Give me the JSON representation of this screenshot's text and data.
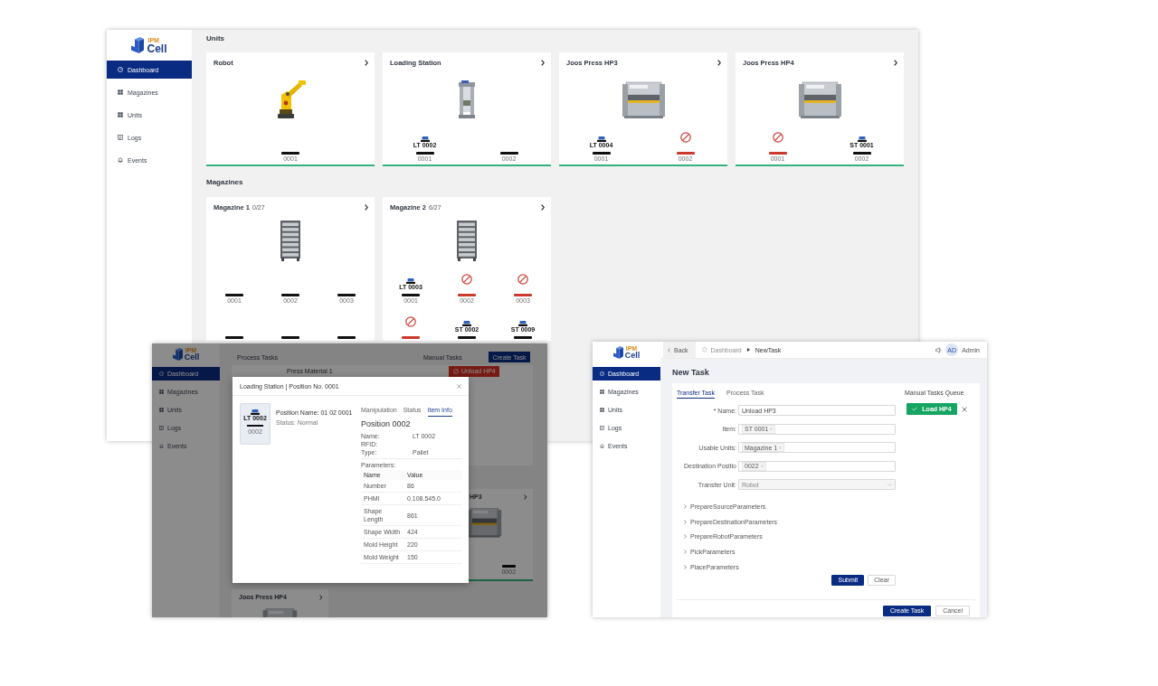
{
  "dashboard_window": {
    "logo": {
      "tag": "IPM",
      "name": "Cell"
    },
    "sidebar": [
      {
        "label": "Dashboard",
        "kind": "gauge",
        "selected": true
      },
      {
        "label": "Magazines",
        "kind": "grid",
        "selected": false
      },
      {
        "label": "Units",
        "kind": "grid",
        "selected": false
      },
      {
        "label": "Logs",
        "kind": "document",
        "selected": false
      },
      {
        "label": "Events",
        "kind": "bell",
        "selected": false
      }
    ],
    "units": {
      "title": "Units",
      "cards": [
        {
          "title": "Robot",
          "kind": "robot",
          "positions": [
            {
              "number": "0001",
              "blocked": false
            }
          ]
        },
        {
          "title": "Loading Station",
          "kind": "station",
          "positions": [
            {
              "number": "0001",
              "item": "LT 0002",
              "blocked": false
            },
            {
              "number": "0002",
              "blocked": false
            }
          ]
        },
        {
          "title": "Joos Press HP3",
          "kind": "press",
          "positions": [
            {
              "number": "0001",
              "item": "LT 0004",
              "blocked": false
            },
            {
              "number": "0002",
              "blocked": true
            }
          ]
        },
        {
          "title": "Joos Press HP4",
          "kind": "press",
          "positions": [
            {
              "number": "0001",
              "blocked": true
            },
            {
              "number": "0002",
              "item": "ST 0001",
              "blocked": false
            }
          ]
        }
      ]
    },
    "magazines": {
      "title": "Magazines",
      "cards": [
        {
          "title": "Magazine 1",
          "count": "0/27",
          "kind": "rack",
          "positions": [
            {
              "number": "0001",
              "blocked": false
            },
            {
              "number": "0002",
              "blocked": false
            },
            {
              "number": "0003",
              "blocked": false
            },
            {
              "blocked": false
            },
            {
              "blocked": false
            },
            {
              "blocked": false
            }
          ]
        },
        {
          "title": "Magazine 2",
          "count": "6/27",
          "kind": "rack",
          "positions": [
            {
              "number": "0001",
              "item": "LT 0003",
              "blocked": false
            },
            {
              "number": "0002",
              "blocked": true
            },
            {
              "number": "0003",
              "blocked": true
            },
            {
              "blocked": true
            },
            {
              "item": "ST 0002",
              "blocked": false
            },
            {
              "item": "ST 0009",
              "blocked": false
            }
          ]
        }
      ]
    }
  },
  "item_info_window": {
    "logo": {
      "tag": "IPM",
      "name": "Cell"
    },
    "sidebar": [
      {
        "label": "Dashboard",
        "kind": "gauge",
        "selected": true
      },
      {
        "label": "Magazines",
        "kind": "grid",
        "selected": false
      },
      {
        "label": "Units",
        "kind": "grid",
        "selected": false
      },
      {
        "label": "Logs",
        "kind": "document",
        "selected": false
      },
      {
        "label": "Events",
        "kind": "bell",
        "selected": false
      }
    ],
    "process_title": "Process Tasks",
    "manual_title": "Manual Tasks",
    "create_button": "Create Task",
    "process_tasks": [
      "Press Material 1"
    ],
    "manual_tasks": [
      {
        "label": "Unload HP4"
      }
    ],
    "unit_cards": [
      {
        "title": "HP3",
        "kind": "press",
        "positions": [
          {
            "number": "0002",
            "blocked": false
          }
        ]
      },
      {
        "title": "Joos Press HP4",
        "kind": "press"
      }
    ],
    "dialog": {
      "title": "Loading Station | Position No. 0001",
      "slot": {
        "item": "LT 0002",
        "number": "0002",
        "blocked": false
      },
      "position_name": "Position Name: 01 02 0001",
      "status": "Status: Normal",
      "tabs": [
        {
          "label": "Manipulation",
          "selected": false
        },
        {
          "label": "Status",
          "selected": false
        },
        {
          "label": "Item Info",
          "selected": true
        }
      ],
      "heading": "Position 0002",
      "fields": [
        {
          "label": "Name:",
          "value": "LT 0002"
        },
        {
          "label": "RFID:"
        },
        {
          "label": "Type:",
          "value": "Pallet"
        }
      ],
      "parameters_label": "Parameters:",
      "columns": [
        "Name",
        "Value"
      ],
      "parameters": [
        {
          "name": "Number",
          "value": "86"
        },
        {
          "name": "PHMI",
          "value": "0.108.545.0"
        },
        {
          "name": "Shape Length",
          "value": "861"
        },
        {
          "name": "Shape Width",
          "value": "424"
        },
        {
          "name": "Mold Height",
          "value": "220"
        },
        {
          "name": "Mold Weight",
          "value": "150"
        }
      ]
    }
  },
  "new_task_window": {
    "logo": {
      "tag": "IPM",
      "name": "Cell"
    },
    "sidebar": [
      {
        "label": "Dashboard",
        "kind": "gauge",
        "selected": true
      },
      {
        "label": "Magazines",
        "kind": "grid",
        "selected": false
      },
      {
        "label": "Units",
        "kind": "grid",
        "selected": false
      },
      {
        "label": "Logs",
        "kind": "document",
        "selected": false
      },
      {
        "label": "Events",
        "kind": "bell",
        "selected": false
      }
    ],
    "back_button": "Back",
    "breadcrumb": [
      "Dashboard",
      "NewTask"
    ],
    "user": {
      "initials": "AD",
      "name": "Admin"
    },
    "title": "New Task",
    "tabs": [
      {
        "label": "Transfer Task",
        "selected": true
      },
      {
        "label": "Process Task",
        "selected": false
      }
    ],
    "form": [
      {
        "kind": "text",
        "label": "* Name:",
        "value": "Unload HP3"
      },
      {
        "kind": "tags",
        "label": "Item:",
        "tags": [
          "ST 0001"
        ]
      },
      {
        "kind": "tags",
        "label": "Usable Units:",
        "tags": [
          "Magazine 1"
        ]
      },
      {
        "kind": "tags",
        "label": "Destination Positio",
        "tags": [
          "0022"
        ]
      },
      {
        "kind": "select",
        "label": "Transfer Unit:",
        "value": "Robot",
        "disabled": true
      }
    ],
    "sections": [
      {
        "label": "PrepareSourceParameters",
        "expanded": false
      },
      {
        "label": "PrepareDestinationParameters",
        "expanded": false
      },
      {
        "label": "PrepareRobotParameters",
        "expanded": false
      },
      {
        "label": "PickParameters",
        "expanded": false
      },
      {
        "label": "PlaceParameters",
        "expanded": false
      }
    ],
    "form_buttons": [
      {
        "label": "Submit",
        "primary": true
      },
      {
        "label": "Clear",
        "primary": false
      }
    ],
    "queue": {
      "title": "Manual Tasks Queue",
      "items": [
        {
          "label": "Load HP4",
          "done": true
        }
      ]
    },
    "footer_buttons": [
      {
        "label": "Create Task",
        "primary": true
      },
      {
        "label": "Cancel",
        "primary": false
      }
    ]
  }
}
